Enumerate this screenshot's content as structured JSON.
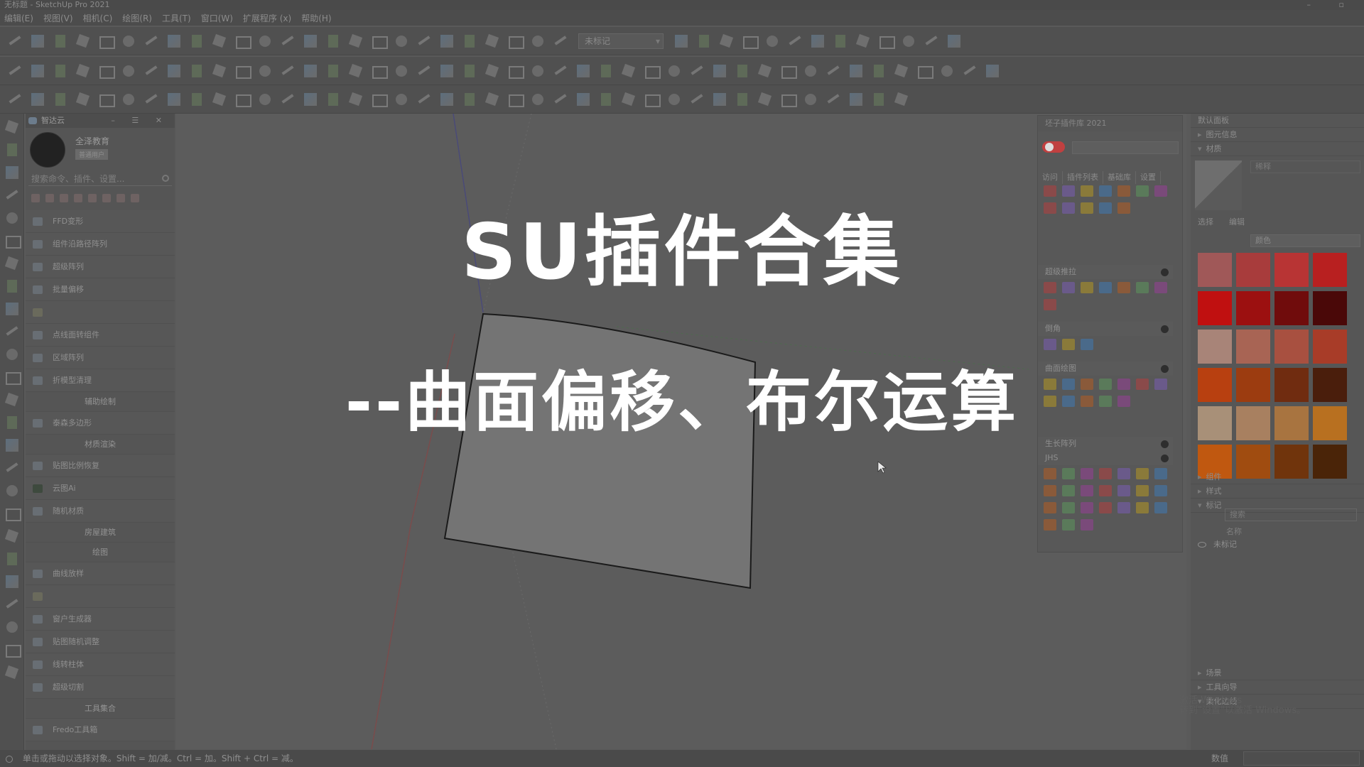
{
  "window": {
    "title": "无标题 - SketchUp Pro 2021"
  },
  "menu": [
    "编辑(E)",
    "视图(V)",
    "相机(C)",
    "绘图(R)",
    "工具(T)",
    "窗口(W)",
    "扩展程序 (x)",
    "帮助(H)"
  ],
  "toolbar": {
    "tag_dropdown": "未标记"
  },
  "left_panel": {
    "title": "智达云",
    "user_name": "全泽教育",
    "user_badge": "普通用户",
    "search_placeholder": "搜索命令、插件、设置...",
    "items": [
      {
        "label": "FFD变形",
        "type": "item"
      },
      {
        "label": "组件沿路径阵列",
        "type": "item"
      },
      {
        "label": "超级阵列",
        "type": "item"
      },
      {
        "label": "批量偏移",
        "type": "item"
      },
      {
        "label": "",
        "type": "blank"
      },
      {
        "label": "点线面转组件",
        "type": "item"
      },
      {
        "label": "区域阵列",
        "type": "item"
      },
      {
        "label": "折模型清理",
        "type": "item"
      },
      {
        "label": "辅助绘制",
        "type": "section"
      },
      {
        "label": "泰森多边形",
        "type": "item"
      },
      {
        "label": "材质渲染",
        "type": "section"
      },
      {
        "label": "贴图比例恢复",
        "type": "item"
      },
      {
        "label": "云图Ai",
        "type": "ai"
      },
      {
        "label": "随机材质",
        "type": "item"
      },
      {
        "label": "房屋建筑",
        "type": "section"
      },
      {
        "label": "绘图",
        "type": "section"
      },
      {
        "label": "曲线放样",
        "type": "item"
      },
      {
        "label": "",
        "type": "blank"
      },
      {
        "label": "窗户生成器",
        "type": "item"
      },
      {
        "label": "贴图随机调整",
        "type": "item"
      },
      {
        "label": "线转柱体",
        "type": "item"
      },
      {
        "label": "超级切割",
        "type": "item"
      },
      {
        "label": "工具集合",
        "type": "section"
      },
      {
        "label": "Fredo工具箱",
        "type": "item"
      }
    ]
  },
  "plugin_library": {
    "title": "坯子插件库 2021",
    "tabs": [
      "访问",
      "插件列表",
      "基础库",
      "设置"
    ],
    "sections": [
      "超级推拉",
      "倒角",
      "曲面绘图",
      "生长阵列",
      "JHS"
    ]
  },
  "default_panel": {
    "title": "默认面板",
    "entity_info": "图元信息",
    "materials": "材质",
    "material_name": "稀释",
    "select_tab": "选择",
    "edit_tab": "编辑",
    "category": "颜色",
    "swatches": [
      "#a05858",
      "#a83c3c",
      "#b83434",
      "#b82020",
      "#c01010",
      "#9c1010",
      "#700c0c",
      "#4a0808",
      "#a88478",
      "#a86454",
      "#a85040",
      "#a83c28",
      "#b84010",
      "#9c3c10",
      "#702c10",
      "#4a1e0c",
      "#a89078",
      "#a88060",
      "#a87440",
      "#b87020",
      "#c05810",
      "#a04c10",
      "#70340c",
      "#4a2408"
    ],
    "components": "组件",
    "styles": "样式",
    "tags": "标记",
    "tag_search": "搜索",
    "tag_name_header": "名称",
    "tag_untagged": "未标记",
    "scenes": "场景",
    "instructor": "工具向导",
    "soften": "柔化边线"
  },
  "watermark": [
    "激活 Windows",
    "转到\"设置\"以激活 Windows。"
  ],
  "status": {
    "hint": "单击或拖动以选择对象。Shift = 加/减。Ctrl = 加。Shift + Ctrl = 减。",
    "measure_label": "数值"
  },
  "overlay": {
    "title": "SU插件合集",
    "subtitle": "--曲面偏移、布尔运算"
  }
}
